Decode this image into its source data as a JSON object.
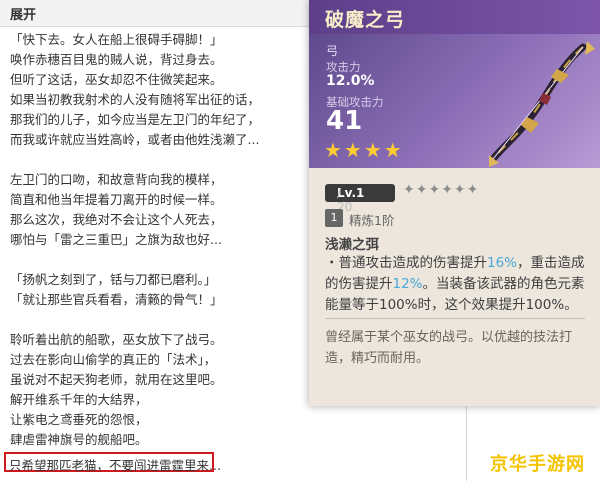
{
  "story": {
    "header": "展开",
    "lines": [
      "「快下去。女人在船上很碍手碍脚！」",
      "唤作赤穗百目鬼的贼人说，背过身去。",
      "但听了这话，巫女却忍不住微笑起来。",
      "如果当初教我射术的人没有随将军出征的话，",
      "那我们的儿子，如今应当是左卫门的年纪了，",
      "而我或许就应当姓高岭，或者由他姓浅濑了...",
      "左卫门的口吻，和故意背向我的模样，",
      "简直和他当年提着刀离开的时候一样。",
      "那么这次，我绝对不会让这个人死去，",
      "哪怕与「雷之三重巴」之旗为敌也好...",
      "「扬帆之刻到了，铦与刀都已磨利。」",
      "「就让那些官兵看看，清籁的骨气！」",
      "聆听着出航的船歌，巫女放下了战弓。",
      "过去在影向山偷学的真正的「法术」，",
      "虽说对不起天狗老师，就用在这里吧。",
      "解开维系千年的大结界，",
      "让紫电之鸢垂死的怨恨，",
      "肆虐雷神旗号的舰船吧。"
    ],
    "highlighted_line": "只希望那匹老猫，不要闯进雷霆里来..."
  },
  "card": {
    "title": "破魔之弓",
    "type": "弓",
    "secondary_label": "攻击力",
    "secondary_value": "12.0%",
    "base_label": "基础攻击力",
    "base_value": "41",
    "rarity_stars": "★★★★",
    "level": "Lv.1",
    "level_max": "/ 20",
    "ascension_stars": "✦✦✦✦✦✦",
    "refinement_num": "1",
    "refinement_label": "精炼1阶",
    "passive_name": "浅濑之弭",
    "passive": {
      "p1": "・普通攻击造成的伤害提升",
      "v1": "16%",
      "p2": "，重击造成的伤害提升",
      "v2": "12%",
      "p3": "。当装备该武器的角色元素能量等于100%时，这个效果提升100%。"
    },
    "lore": "曾经属于某个巫女的战弓。以优越的技法打造，精巧而耐用。"
  },
  "watermark": "京华手游网",
  "colors": {
    "card_title_bg": "#6a4a96",
    "star": "#ffcc33",
    "highlight_border": "#d0191f",
    "passive_value": "#4aa8d8",
    "watermark": "#f6c300"
  }
}
